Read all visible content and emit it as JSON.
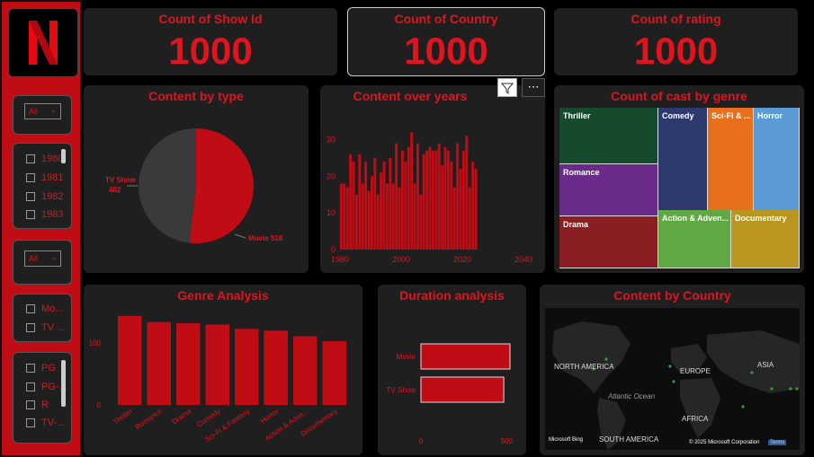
{
  "colors": {
    "accent": "#e0141e",
    "bar": "#c00d15",
    "panel": "#1f1f1f"
  },
  "logo": {
    "letter": "N"
  },
  "slicers": {
    "dropdown1": {
      "value": "All",
      "icon": "chevron-down-icon"
    },
    "years": [
      "1980",
      "1981",
      "1982",
      "1983"
    ],
    "dropdown2": {
      "value": "All",
      "icon": "chevron-down-icon"
    },
    "types": [
      "Mo...",
      "TV ..."
    ],
    "ratings": [
      "PG",
      "PG-...",
      "R",
      "TV-..."
    ]
  },
  "kpis": [
    {
      "title": "Count of Show Id",
      "value": "1000"
    },
    {
      "title": "Count of Country",
      "value": "1000"
    },
    {
      "title": "Count of rating",
      "value": "1000"
    }
  ],
  "visual_header": {
    "filter_icon": "filter-icon",
    "more_icon": "more-options-icon",
    "more": "⋯"
  },
  "charts": {
    "content_by_type": {
      "title": "Content by type"
    },
    "content_over_years": {
      "title": "Content over years"
    },
    "cast_by_genre": {
      "title": "Count of cast by genre"
    },
    "genre_analysis": {
      "title": "Genre Analysis"
    },
    "duration_analysis": {
      "title": "Duration analysis"
    },
    "content_by_country": {
      "title": "Content by Country"
    }
  },
  "chart_data": [
    {
      "type": "pie",
      "title": "Content by type",
      "categories": [
        "TV Show",
        "Movie"
      ],
      "values": [
        482,
        518
      ],
      "labels": [
        "TV Show",
        "Movie 518"
      ],
      "label_values": [
        "482"
      ],
      "colors": [
        "#3a3a3a",
        "#c00d15"
      ]
    },
    {
      "type": "bar",
      "title": "Content over years",
      "ylim": [
        0,
        35
      ],
      "yticks": [
        0,
        10,
        20,
        30
      ],
      "xticks": [
        "1980",
        "2000",
        "2020",
        "2040"
      ],
      "xrange": [
        1980,
        2040
      ],
      "x": [
        1980,
        1981,
        1982,
        1983,
        1984,
        1985,
        1986,
        1987,
        1988,
        1989,
        1990,
        1991,
        1992,
        1993,
        1994,
        1995,
        1996,
        1997,
        1998,
        1999,
        2000,
        2001,
        2002,
        2003,
        2004,
        2005,
        2006,
        2007,
        2008,
        2009,
        2010,
        2011,
        2012,
        2013,
        2014,
        2015,
        2016,
        2017,
        2018,
        2019,
        2020,
        2021,
        2022,
        2023,
        2024
      ],
      "values": [
        18,
        18,
        17,
        26,
        24,
        15,
        26,
        18,
        24,
        16,
        20,
        25,
        15,
        21,
        24,
        18,
        25,
        18,
        29,
        17,
        27,
        24,
        28,
        32,
        18,
        29,
        15,
        26,
        27,
        28,
        27,
        27,
        29,
        23,
        28,
        27,
        24,
        17,
        29,
        22,
        27,
        31,
        17,
        24,
        22
      ]
    },
    {
      "type": "treemap",
      "title": "Count of cast by genre",
      "categories": [
        "Thriller",
        "Comedy",
        "Sci-Fi & ...",
        "Horror",
        "Romance",
        "Drama",
        "Action & Adven...",
        "Documentary"
      ],
      "colors": [
        "#164a2c",
        "#2e3a6e",
        "#e8701c",
        "#5b9bd5",
        "#6a2a8a",
        "#8b1e22",
        "#5fa843",
        "#b8961f"
      ]
    },
    {
      "type": "bar",
      "title": "Genre Analysis",
      "categories": [
        "Thriller",
        "Romance",
        "Drama",
        "Comedy",
        "Sci-Fi & Fantasy",
        "Horror",
        "Action & Adve...",
        "Documentary"
      ],
      "values": [
        144,
        134,
        132,
        130,
        123,
        120,
        111,
        103
      ],
      "ylim": [
        0,
        180
      ],
      "yticks": [
        0,
        100
      ]
    },
    {
      "type": "bar",
      "orientation": "horizontal",
      "title": "Duration analysis",
      "categories": [
        "Movie",
        "TV Show"
      ],
      "values": [
        518,
        482
      ],
      "xlim": [
        0,
        560
      ],
      "xticks": [
        0,
        500
      ]
    },
    {
      "type": "map",
      "title": "Content by Country",
      "labels": [
        "NORTH AMERICA",
        "EUROPE",
        "ASIA",
        "AFRICA",
        "SOUTH AMERICA",
        "Atlantic Ocean"
      ],
      "attribution": "© 2025 Microsoft Corporation",
      "brand": "Microsoft Bing",
      "terms": "Terms"
    }
  ]
}
